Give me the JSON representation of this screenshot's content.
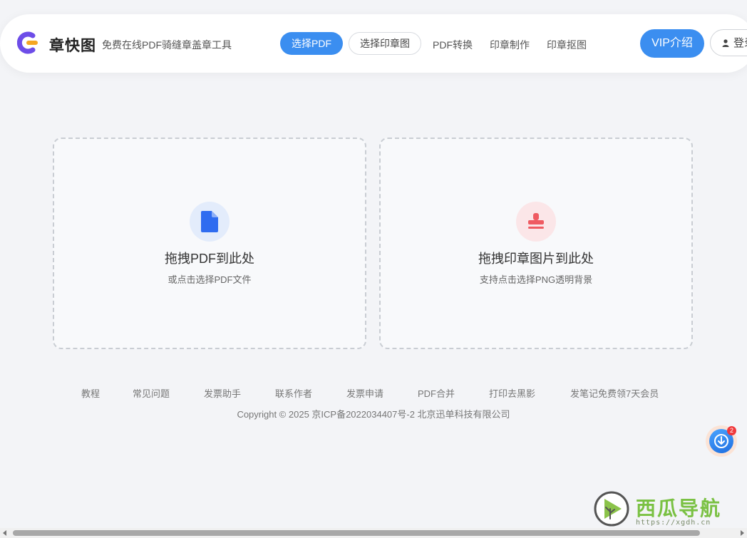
{
  "header": {
    "brand_name": "章快图",
    "slogan": "免费在线PDF骑缝章盖章工具",
    "nav": {
      "select_pdf": "选择PDF",
      "select_stamp": "选择印章图",
      "pdf_convert": "PDF转换",
      "stamp_make": "印章制作",
      "stamp_cutout": "印章抠图"
    },
    "vip": "VIP介绍",
    "login": "登录"
  },
  "drop_zones": {
    "pdf": {
      "title": "拖拽PDF到此处",
      "subtitle": "或点击选择PDF文件",
      "icon": "file-icon"
    },
    "stamp": {
      "title": "拖拽印章图片到此处",
      "subtitle": "支持点击选择PNG透明背景",
      "icon": "stamp-icon"
    }
  },
  "footer": {
    "links": [
      "教程",
      "常见问题",
      "发票助手",
      "联系作者",
      "发票申请",
      "PDF合并",
      "打印去黑影",
      "发笔记免费领7天会员"
    ],
    "copyright": "Copyright © 2025 京ICP备2022034407号-2 北京迅单科技有限公司"
  },
  "floating": {
    "badge_count": "2"
  },
  "watermark": {
    "title": "西瓜导航",
    "url": "https://xgdh.cn"
  },
  "colors": {
    "primary": "#3b8ef0",
    "brand_purple": "#6d4de8",
    "brand_orange": "#f5a623",
    "stamp_red": "#ef5b62"
  }
}
